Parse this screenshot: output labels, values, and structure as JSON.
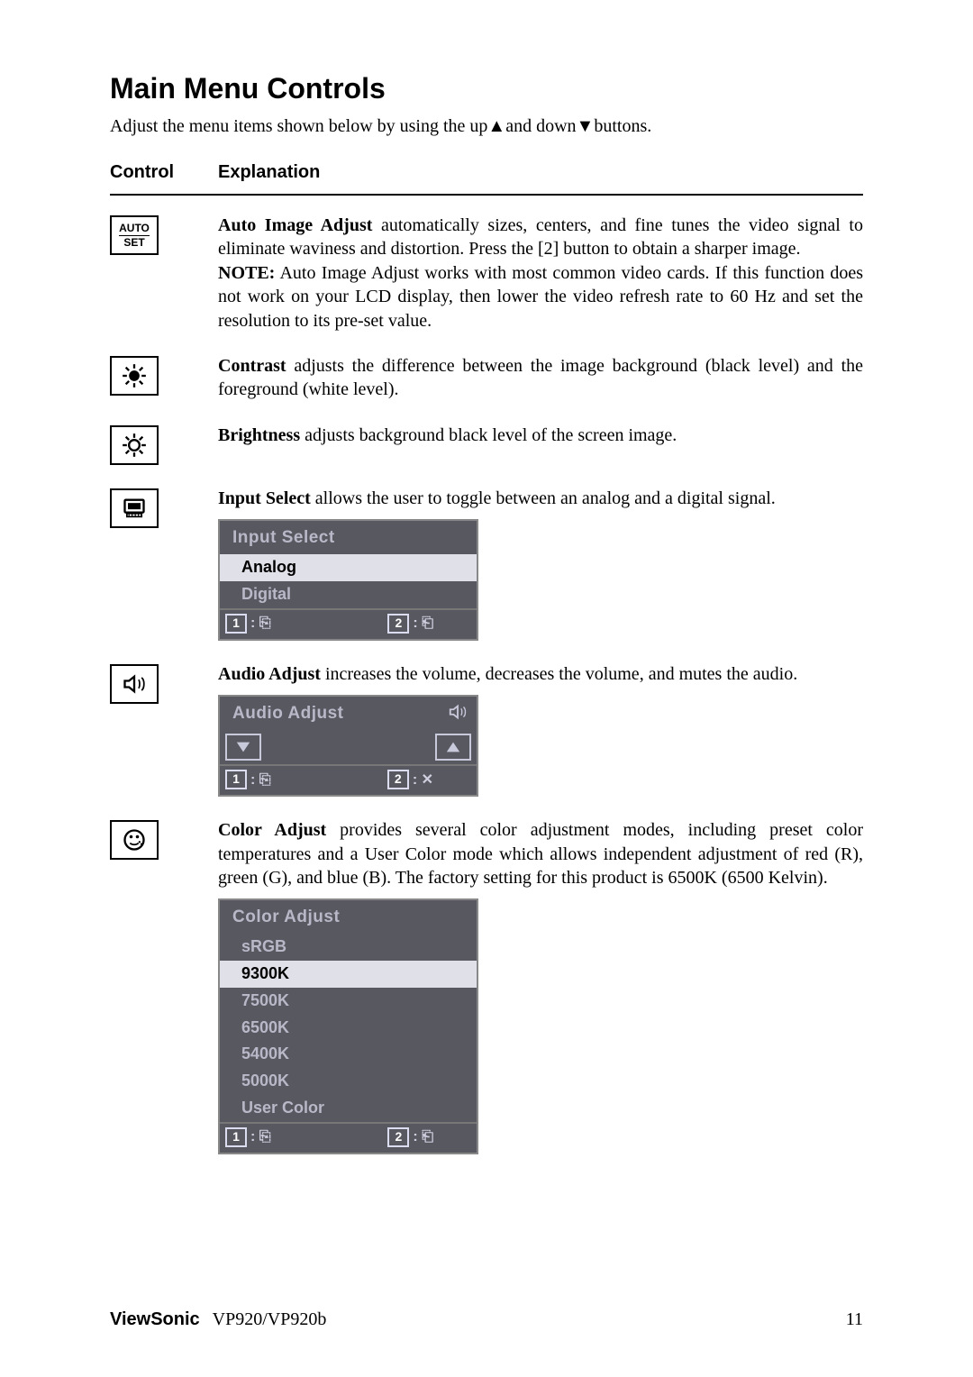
{
  "page": {
    "title": "Main Menu Controls",
    "intro_pre": "Adjust the menu items shown below by using the up",
    "intro_mid": "and down",
    "intro_post": "buttons."
  },
  "headers": {
    "control": "Control",
    "explanation": "Explanation"
  },
  "icons": {
    "auto_set_l1": "AUTO",
    "auto_set_l2": "SET"
  },
  "sections": {
    "auto_image": {
      "title": "Auto Image Adjust",
      "text": " automatically sizes, centers, and fine tunes the video signal to eliminate waviness and distortion. Press the [2] button to obtain a sharper image.",
      "note_label": "NOTE:",
      "note_text": " Auto Image Adjust works with most common video cards. If this function does not work on your LCD display, then lower the video refresh rate to 60 Hz and set the resolution to its pre-set value."
    },
    "contrast": {
      "title": "Contrast",
      "text": " adjusts the difference between the image background  (black level) and the foreground (white level)."
    },
    "brightness": {
      "title": "Brightness",
      "text": " adjusts background black level of the screen image."
    },
    "input_select": {
      "title": "Input Select",
      "text": " allows the user to toggle between an analog and a digital signal."
    },
    "audio_adjust": {
      "title": "Audio Adjust",
      "text": " increases the volume, decreases the volume, and mutes the audio."
    },
    "color_adjust": {
      "title": "Color Adjust",
      "text": " provides several color adjustment modes, including preset color temperatures and a User Color mode which allows independent adjustment of red (R), green (G), and blue (B). The factory setting for this product is 6500K (6500 Kelvin)."
    }
  },
  "osd": {
    "input_select": {
      "title": "Input Select",
      "options": [
        "Analog",
        "Digital"
      ],
      "selected_index": 0,
      "foot1": "1",
      "foot2": "2"
    },
    "audio_adjust": {
      "title": "Audio Adjust",
      "foot1": "1",
      "foot2": "2"
    },
    "color_adjust": {
      "title": "Color Adjust",
      "options": [
        "sRGB",
        "9300K",
        "7500K",
        "6500K",
        "5400K",
        "5000K",
        "User Color"
      ],
      "selected_index": 1,
      "foot1": "1",
      "foot2": "2"
    }
  },
  "footer": {
    "brand": "ViewSonic",
    "model": "VP920/VP920b",
    "page_number": "11"
  }
}
